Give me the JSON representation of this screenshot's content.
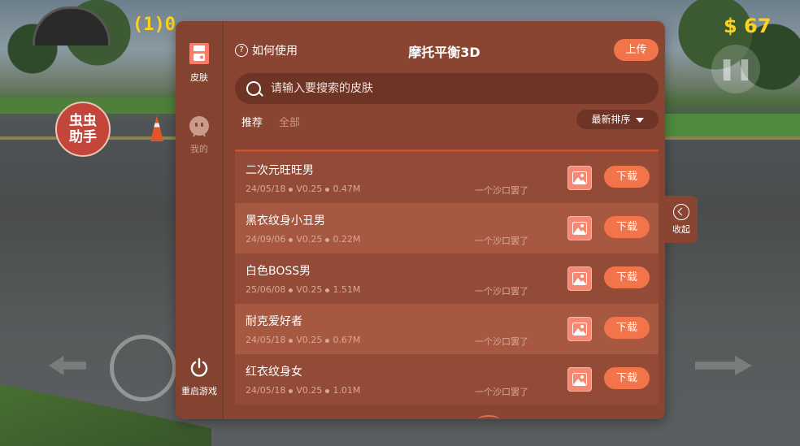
{
  "hud": {
    "lives_text": "(1)0",
    "money_text": "$ 67",
    "badge_text": "虫虫助手"
  },
  "sidebar": {
    "items": [
      {
        "label": "皮肤",
        "icon": "skin-icon"
      },
      {
        "label": "我的",
        "icon": "face-icon"
      },
      {
        "label": "重启游戏",
        "icon": "power-icon"
      }
    ]
  },
  "header": {
    "howto_label": "如何使用",
    "title": "摩托平衡3D",
    "upload_label": "上传"
  },
  "search": {
    "placeholder": "请输入要搜索的皮肤"
  },
  "tabs": [
    {
      "label": "推荐",
      "active": true
    },
    {
      "label": "全部",
      "active": false
    }
  ],
  "sort": {
    "label": "最新排序"
  },
  "skins": [
    {
      "name": "二次元旺旺男",
      "date": "24/05/18",
      "version": "V0.25",
      "size": "0.47M",
      "author": "一个沙口罢了",
      "download": "下载"
    },
    {
      "name": "黑衣纹身小丑男",
      "date": "24/09/06",
      "version": "V0.25",
      "size": "0.22M",
      "author": "一个沙口罢了",
      "download": "下载"
    },
    {
      "name": "白色BOSS男",
      "date": "25/06/08",
      "version": "V0.25",
      "size": "1.51M",
      "author": "一个沙口罢了",
      "download": "下载"
    },
    {
      "name": "耐克爱好者",
      "date": "24/05/18",
      "version": "V0.25",
      "size": "0.67M",
      "author": "一个沙口罢了",
      "download": "下载"
    },
    {
      "name": "红衣纹身女",
      "date": "24/05/18",
      "version": "V0.25",
      "size": "1.01M",
      "author": "一个沙口罢了",
      "download": "下载"
    }
  ],
  "collapse": {
    "label": "收起"
  },
  "colors": {
    "panel": "#8a4532",
    "accent": "#f1744a"
  }
}
